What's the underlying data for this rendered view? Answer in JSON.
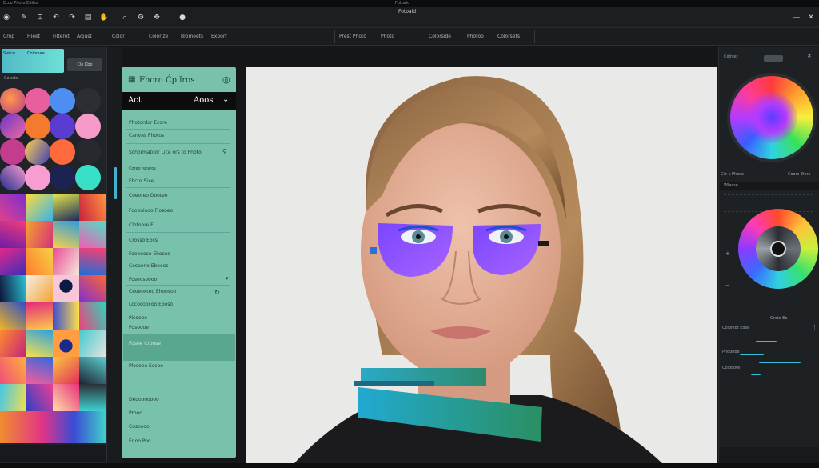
{
  "window": {
    "title_left": "Ecco Photo Editor",
    "title_center": "Fotoaid"
  },
  "toolbar": {
    "title": "Fotoaid"
  },
  "menu": {
    "items": [
      "Crop",
      "Fileet",
      "Filteret",
      "Adjust",
      "Color",
      "Colorize",
      "Blomeets",
      "Export",
      "Prest Photo",
      "Photo",
      "Colorside",
      "Photoo",
      "Colorsets"
    ]
  },
  "left_panel": {
    "header_a": "Swtce",
    "header_b": "Colorsee",
    "tab_a": "Colodo",
    "tab_b": "Clo Kbo"
  },
  "layers_panel": {
    "title": "Fhcro Ćp ǐros",
    "bar_left": "Act",
    "bar_right": "Aoos",
    "rows": [
      "Photordor Ecore",
      "Canvas Photos",
      "Schormatoor Lice ors to Photo",
      "Coreo retaros",
      "Fhcto Sixe",
      "Coeoreo Dootee",
      "Foooniooo Fiosoeo",
      "Clotoore F",
      "Crosso Eocs",
      "Foooeoso Ehosoo",
      "Cosoono Ebooos",
      "Fosoosoooo",
      "Ceoeoxteo Ehoosoo",
      "Lococoocoo Eooso",
      "Pisoooo",
      "Posoooe",
      "Fosoe Croose",
      "Plosoeo Eosoo",
      "Deoooooooo",
      "Prooo",
      "Cosoooo",
      "Enoo Poo"
    ]
  },
  "right_panel": {
    "label_top": "Colrcet",
    "label_mid": "Clo-s Phose",
    "label_mid_r": "Coors Elore",
    "label_a": "Wlacse",
    "label_b": "Orsto Eo",
    "label_c": "Colorsot Eose",
    "label_d": "Phooobe",
    "label_e": "Colooote"
  },
  "colors": {
    "panel_teal": "#78c2ad",
    "accent_cyan": "#39c1d9",
    "eye_purple": "#8a4dff"
  },
  "icons": [
    "eye-icon",
    "brush-icon",
    "crop-icon",
    "undo-icon",
    "redo-icon",
    "layers-icon",
    "settings-icon",
    "close-icon",
    "lock-icon",
    "plus-icon"
  ]
}
